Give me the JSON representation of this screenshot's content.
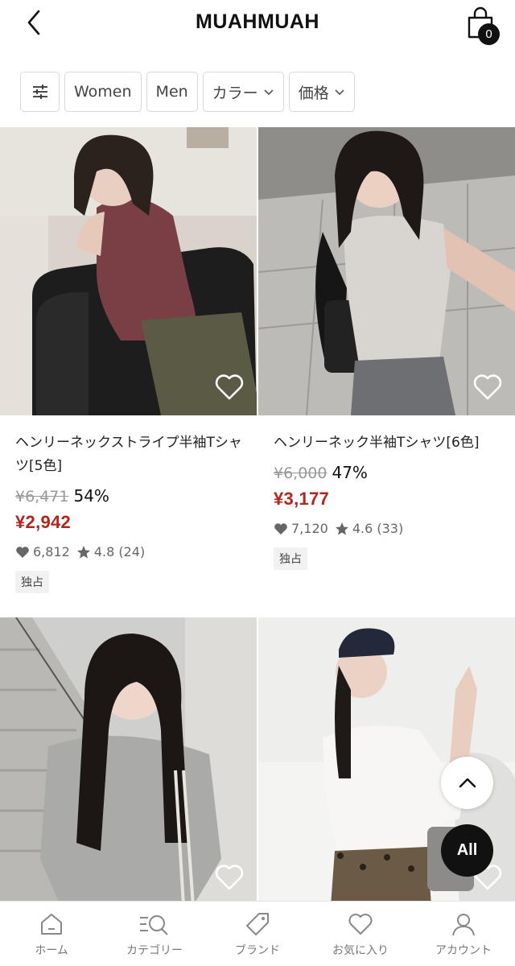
{
  "header": {
    "title": "MUAHMUAH",
    "cart_count": "0"
  },
  "filters": {
    "items": [
      {
        "label": "Women"
      },
      {
        "label": "Men"
      },
      {
        "label": "カラー"
      },
      {
        "label": "価格"
      }
    ]
  },
  "products": [
    {
      "title": "ヘンリーネックストライプ半袖Tシャツ[5色]",
      "original_price": "¥6,471",
      "discount": "54%",
      "price": "¥2,942",
      "likes": "6,812",
      "rating": "4.8",
      "reviews": "(24)",
      "tag": "独占"
    },
    {
      "title": "ヘンリーネック半袖Tシャツ[6色]",
      "original_price": "¥6,000",
      "discount": "47%",
      "price": "¥3,177",
      "likes": "7,120",
      "rating": "4.6",
      "reviews": "(33)",
      "tag": "独占"
    },
    {
      "title": "",
      "image": "woman-grey-tee-stairs"
    },
    {
      "title": "",
      "image": "woman-white-henley-cap"
    }
  ],
  "fab": {
    "all_label": "All"
  },
  "bottom_nav": {
    "items": [
      {
        "label": "ホーム",
        "icon": "home-icon"
      },
      {
        "label": "カテゴリー",
        "icon": "category-search-icon"
      },
      {
        "label": "ブランド",
        "icon": "tag-icon"
      },
      {
        "label": "お気に入り",
        "icon": "heart-icon"
      },
      {
        "label": "アカウント",
        "icon": "user-icon"
      }
    ]
  },
  "colors": {
    "price_red": "#b3261e",
    "text": "#111111",
    "muted": "#999999"
  }
}
